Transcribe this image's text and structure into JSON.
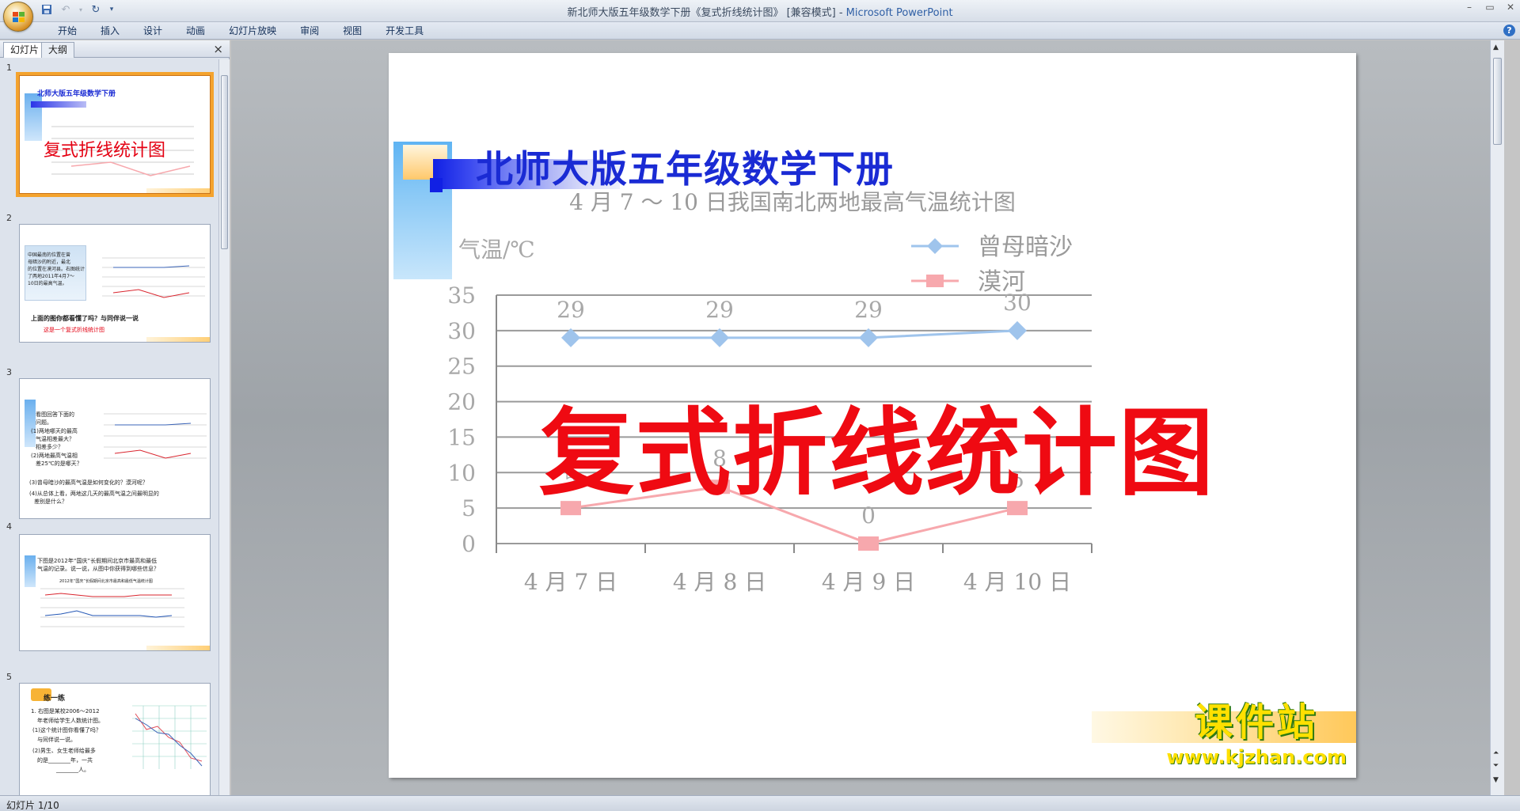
{
  "window": {
    "title": "新北师大版五年级数学下册《复式折线统计图》 [兼容模式] - ",
    "app_name": "Microsoft PowerPoint",
    "controls": [
      "–",
      "▭",
      "✕"
    ]
  },
  "qat": {
    "save_icon": "save-icon",
    "undo_icon": "undo-icon",
    "redo_icon": "redo-icon",
    "customize_icon": "dropdown-icon"
  },
  "ribbon": {
    "tabs": [
      "开始",
      "插入",
      "设计",
      "动画",
      "幻灯片放映",
      "审阅",
      "视图",
      "开发工具"
    ],
    "help": "?"
  },
  "left_panel": {
    "tab_slides": "幻灯片",
    "tab_outline": "大纲",
    "close": "×",
    "thumbnails": [
      {
        "number": "1",
        "title": "北师大版五年级数学下册",
        "overlay": "复式折线统计图"
      },
      {
        "number": "2",
        "lines": [
          "中国最南的位置在曾",
          "母暗沙的附近，最北",
          "的位置在漠河县。右图统计",
          "了两地2011年4月7～",
          "10日的最高气温。"
        ],
        "q1": "上面的图你都看懂了吗？与同伴说一说",
        "q2": "这是一个复式折线统计图"
      },
      {
        "number": "3",
        "lines": [
          "看图回答下面的",
          "问题。",
          "(1)两地哪天的最高",
          "气温相差最大？",
          "相差多少？",
          "(2)两地最高气温相",
          "差25℃的是哪天？",
          "(3)曾母暗沙的最高气温是如何变化的？漠河呢？",
          "(4)从总体上看，两地这几天的最高气温之间最明显的",
          "差别是什么？"
        ]
      },
      {
        "number": "4",
        "lines": [
          "下图是2012年“国庆”长假期间北京市最高和最低",
          "气温的记录。说一说，从图中你获得到哪些信息？"
        ],
        "chart_title": "2012年“国庆”长假期间北京市最高和最低气温统计图"
      },
      {
        "number": "5",
        "heading": "练一练",
        "lines": [
          "1. 右图是某校2006～2012",
          "年老师给学生人数统计图。",
          "(1)这个统计图你看懂了吗？",
          "与同伴说一说。",
          "(2)男生、女生老师给最多",
          "的是________年，一共",
          "________人。"
        ]
      }
    ]
  },
  "slide": {
    "title": "北师大版五年级数学下册",
    "overlay_text": "复式折线统计图",
    "watermark_cn": "课件站",
    "watermark_url": "www.kjzhan.com"
  },
  "chart_data": {
    "type": "line",
    "title": "4 月 7 ～ 10 日我国南北两地最高气温统计图",
    "ylabel": "气温/℃",
    "categories": [
      "4 月 7 日",
      "4 月 8 日",
      "4 月 9 日",
      "4 月 10 日"
    ],
    "yticks": [
      0,
      5,
      10,
      15,
      20,
      25,
      30,
      35
    ],
    "ylim": [
      0,
      35
    ],
    "grid": true,
    "legend": "top-right",
    "series": [
      {
        "name": "曾母暗沙",
        "values": [
          29,
          29,
          29,
          30
        ],
        "color": "#9fc4ec",
        "marker": "diamond"
      },
      {
        "name": "漠河",
        "values": [
          5,
          8,
          0,
          5
        ],
        "color": "#f7a8ad",
        "marker": "square"
      }
    ]
  },
  "status": {
    "slide_counter": "幻灯片 1/10"
  },
  "colors": {
    "title_blue": "#1a2bd4",
    "overlay_red": "#ef0a12",
    "selection_orange": "#f4a32e"
  }
}
